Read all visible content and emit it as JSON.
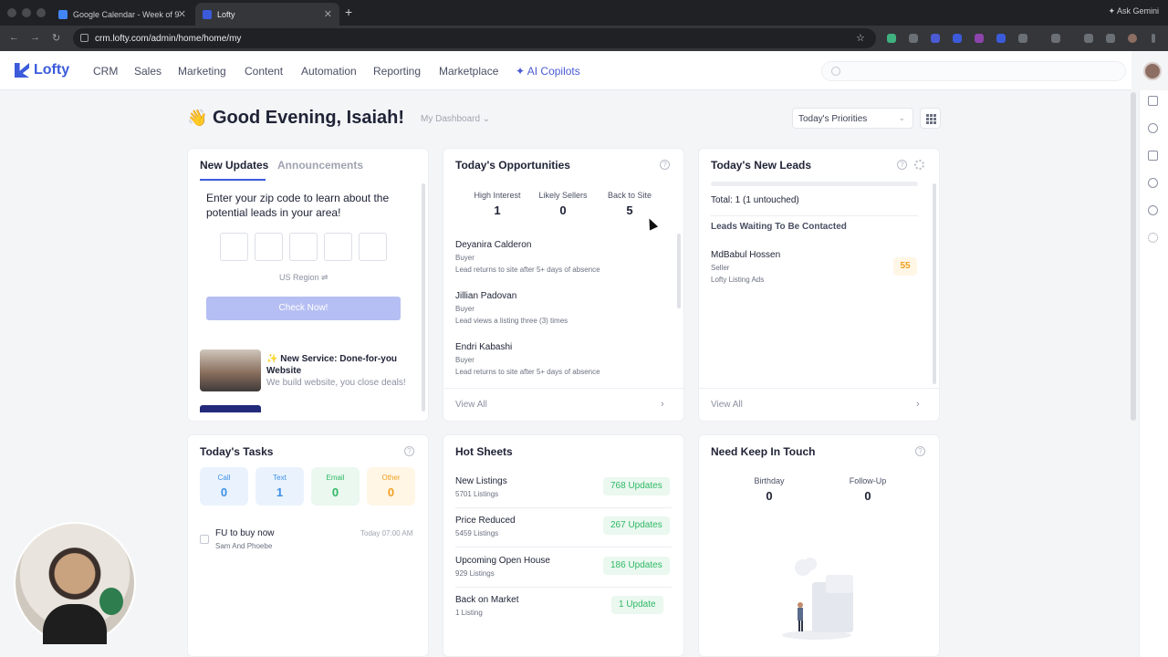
{
  "browser": {
    "tabs": [
      {
        "title": "Google Calendar - Week of 9",
        "active": false
      },
      {
        "title": "Lofty",
        "active": true
      }
    ],
    "url": "crm.lofty.com/admin/home/home/my",
    "gemini_label": "Ask Gemini"
  },
  "app": {
    "brand": "Lofty",
    "nav": [
      "CRM",
      "Sales",
      "Marketing",
      "Content",
      "Automation",
      "Reporting",
      "Marketplace"
    ],
    "ai_nav": "AI Copilots",
    "accent": "#3b5bdb"
  },
  "greeting": {
    "emoji": "👋",
    "text": "Good Evening, Isaiah!",
    "dashboard_label": "My Dashboard",
    "priorities_label": "Today's Priorities"
  },
  "updates": {
    "tabs": [
      "New Updates",
      "Announcements"
    ],
    "zip_prompt": "Enter your zip code to learn about the potential leads in your area!",
    "region": "US Region ⇌",
    "check_button": "Check Now!",
    "promo_title": "✨ New Service: Done-for-you Website",
    "promo_sub": "We build website, you close deals!"
  },
  "opportunities": {
    "title": "Today's Opportunities",
    "stats": [
      {
        "label": "High Interest",
        "value": "1"
      },
      {
        "label": "Likely Sellers",
        "value": "0"
      },
      {
        "label": "Back to Site",
        "value": "5"
      }
    ],
    "items": [
      {
        "name": "Deyanira Calderon",
        "role": "Buyer",
        "desc": "Lead returns to site after 5+ days of absence"
      },
      {
        "name": "Jillian Padovan",
        "role": "Buyer",
        "desc": "Lead views a listing three (3) times"
      },
      {
        "name": "Endri Kabashi",
        "role": "Buyer",
        "desc": "Lead returns to site after 5+ days of absence"
      }
    ],
    "view_all": "View All"
  },
  "leads": {
    "title": "Today's New Leads",
    "total": "Total: 1 (1 untouched)",
    "subtitle": "Leads Waiting To Be Contacted",
    "lead": {
      "name": "MdBabul Hossen",
      "role": "Seller",
      "source": "Lofty Listing Ads",
      "score": "55"
    },
    "view_all": "View All"
  },
  "tasks": {
    "title": "Today's Tasks",
    "types": [
      {
        "label": "Call",
        "value": "0",
        "color": "#3b8fe8",
        "bg": "#eaf3fd"
      },
      {
        "label": "Text",
        "value": "1",
        "color": "#3b8fe8",
        "bg": "#eaf3fd"
      },
      {
        "label": "Email",
        "value": "0",
        "color": "#2fb865",
        "bg": "#eaf8ef"
      },
      {
        "label": "Other",
        "value": "0",
        "color": "#f0a020",
        "bg": "#fff6e6"
      }
    ],
    "item": {
      "title": "FU to buy now",
      "sub": "Sam And Phoebe",
      "time": "Today 07:00 AM"
    }
  },
  "hotsheets": {
    "title": "Hot Sheets",
    "items": [
      {
        "name": "New Listings",
        "count": "5701 Listings",
        "updates": "768 Updates"
      },
      {
        "name": "Price Reduced",
        "count": "5459 Listings",
        "updates": "267 Updates"
      },
      {
        "name": "Upcoming Open House",
        "count": "929 Listings",
        "updates": "186 Updates"
      },
      {
        "name": "Back on Market",
        "count": "1 Listing",
        "updates": "1 Update"
      }
    ]
  },
  "keepintouch": {
    "title": "Need Keep In Touch",
    "stats": [
      {
        "label": "Birthday",
        "value": "0"
      },
      {
        "label": "Follow-Up",
        "value": "0"
      }
    ]
  }
}
